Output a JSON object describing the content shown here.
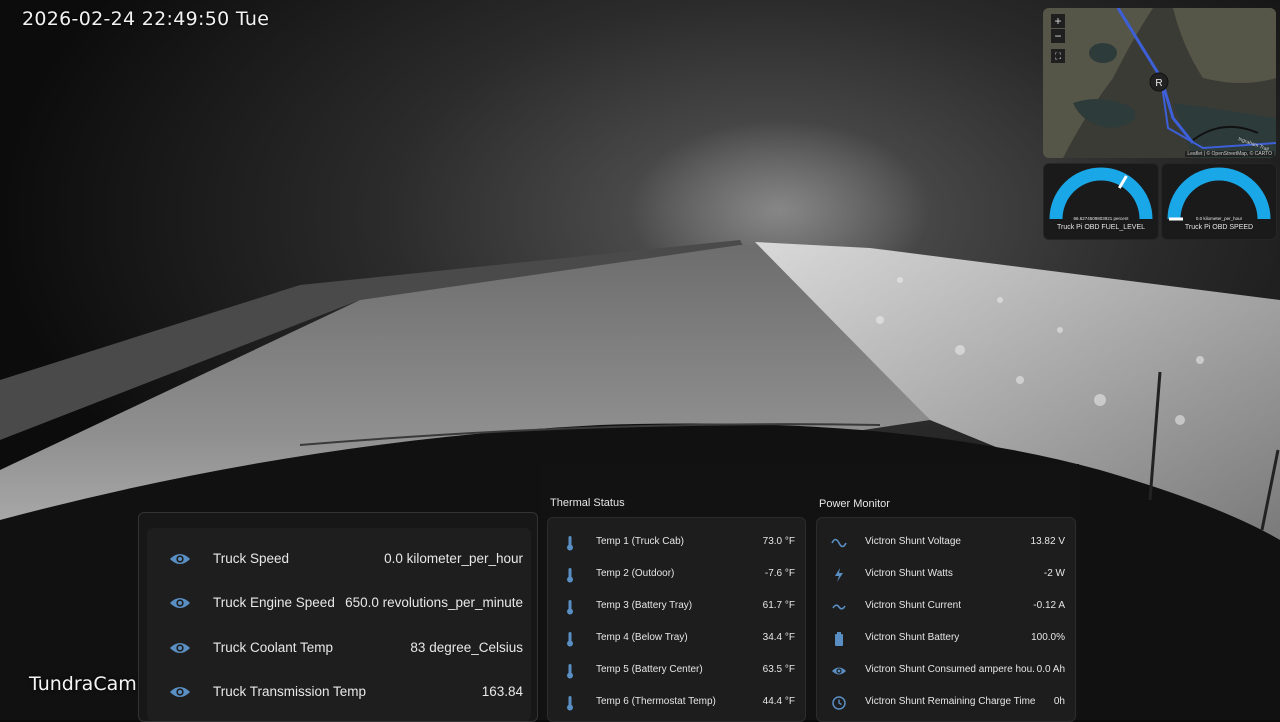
{
  "overlay": {
    "timestamp": "2026-02-24 22:49:50 Tue",
    "brand": "TundraCam"
  },
  "map": {
    "zoom_in": "+",
    "zoom_out": "−",
    "marker_label": "R",
    "attribution": "Leaflet | © OpenStreetMap, © CARTO",
    "road_label": "Ingraham Trail"
  },
  "gauges": [
    {
      "label": "Truck Pi OBD FUEL_LEVEL",
      "value": "66.6274509803921 percent",
      "fraction": 0.67
    },
    {
      "label": "Truck Pi OBD SPEED",
      "value": "0.0 kilometer_per_hour",
      "fraction": 0.0
    }
  ],
  "obd": {
    "rows": [
      {
        "label": "Truck Speed",
        "value": "0.0 kilometer_per_hour",
        "icon": "eye-icon"
      },
      {
        "label": "Truck Engine Speed",
        "value": "650.0 revolutions_per_minute",
        "icon": "eye-icon"
      },
      {
        "label": "Truck Coolant Temp",
        "value": "83 degree_Celsius",
        "icon": "eye-icon"
      },
      {
        "label": "Truck Transmission Temp",
        "value": "163.84",
        "icon": "eye-icon"
      }
    ]
  },
  "thermal": {
    "title": "Thermal Status",
    "rows": [
      {
        "label": "Temp 1 (Truck Cab)",
        "value": "73.0 °F",
        "icon": "thermometer-icon"
      },
      {
        "label": "Temp 2 (Outdoor)",
        "value": "-7.6 °F",
        "icon": "thermometer-icon"
      },
      {
        "label": "Temp 3 (Battery Tray)",
        "value": "61.7 °F",
        "icon": "thermometer-icon"
      },
      {
        "label": "Temp 4 (Below Tray)",
        "value": "34.4 °F",
        "icon": "thermometer-icon"
      },
      {
        "label": "Temp 5 (Battery Center)",
        "value": "63.5 °F",
        "icon": "thermometer-icon"
      },
      {
        "label": "Temp 6 (Thermostat Temp)",
        "value": "44.4 °F",
        "icon": "thermometer-icon"
      }
    ]
  },
  "power": {
    "title": "Power Monitor",
    "rows": [
      {
        "label": "Victron Shunt Voltage",
        "value": "13.82 V",
        "icon": "sine-wave-icon"
      },
      {
        "label": "Victron Shunt Watts",
        "value": "-2 W",
        "icon": "flash-icon"
      },
      {
        "label": "Victron Shunt Current",
        "value": "-0.12 A",
        "icon": "current-wave-icon"
      },
      {
        "label": "Victron Shunt Battery",
        "value": "100.0%",
        "icon": "battery-icon"
      },
      {
        "label": "Victron Shunt Consumed ampere hou...",
        "value": "0.0 Ah",
        "icon": "eye-icon"
      },
      {
        "label": "Victron Shunt Remaining Charge Time",
        "value": "0h",
        "icon": "clock-icon"
      }
    ]
  },
  "colors": {
    "gauge_arc": "#1aa7e8",
    "map_route": "#3d5fd8",
    "icon": "#5a8fc4",
    "text": "#e6e6e6"
  }
}
